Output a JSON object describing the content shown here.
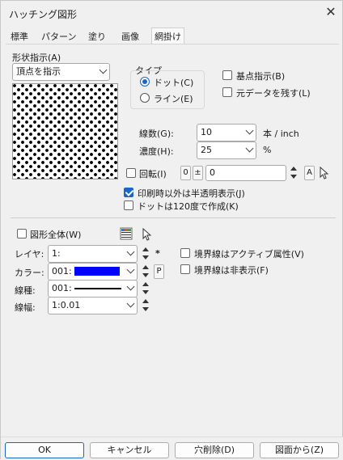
{
  "window": {
    "title": "ハッチング図形",
    "close_glyph": "✕"
  },
  "tabs": [
    {
      "label": "標準"
    },
    {
      "label": "パターン"
    },
    {
      "label": "塗り"
    },
    {
      "label": "画像"
    },
    {
      "label": "網掛け",
      "active": true
    }
  ],
  "shape": {
    "label": "形状指示(A)",
    "selected": "頂点を指示"
  },
  "type_group": {
    "label": "タイプ",
    "options": [
      {
        "label": "ドット(C)",
        "selected": true
      },
      {
        "label": "ライン(E)",
        "selected": false
      }
    ]
  },
  "checks_top": [
    {
      "label": "基点指示(B)",
      "checked": false
    },
    {
      "label": "元データを残す(L)",
      "checked": false
    }
  ],
  "line_count": {
    "label": "線数(G):",
    "value": "10",
    "unit": "本 / inch"
  },
  "density": {
    "label": "濃度(H):",
    "value": "25",
    "unit": "%"
  },
  "rotate": {
    "label": "回転(I)",
    "checked": false,
    "zero_btn": "0",
    "pm_btn": "±",
    "value": "0",
    "a_btn": "A",
    "pointer_icon": "cursor-pointer-icon"
  },
  "checks_mid": [
    {
      "label": "印刷時以外は半透明表示(J)",
      "checked": true
    },
    {
      "label": "ドットは120度で作成(K)",
      "checked": false
    }
  ],
  "whole_shape": {
    "label": "図形全体(W)",
    "checked": false
  },
  "layer": {
    "label": "レイヤ:",
    "value": "1:",
    "extra": "*"
  },
  "color": {
    "label": "カラー:",
    "value": "001:",
    "swatch": "#0000ff",
    "extra": "P"
  },
  "line_type": {
    "label": "線種:",
    "value": "001:"
  },
  "line_width": {
    "label": "線幅:",
    "value": "1:0.01"
  },
  "border_checks": [
    {
      "label": "境界線はアクティブ属性(V)",
      "checked": false
    },
    {
      "label": "境界線は非表示(F)",
      "checked": false
    }
  ],
  "buttons": {
    "ok": "OK",
    "cancel": "キャンセル",
    "hole_delete": "穴削除(D)",
    "from_drawing": "図面から(Z)"
  },
  "colors": {
    "accent": "#1a66c8",
    "background": "#f0f0f0"
  }
}
